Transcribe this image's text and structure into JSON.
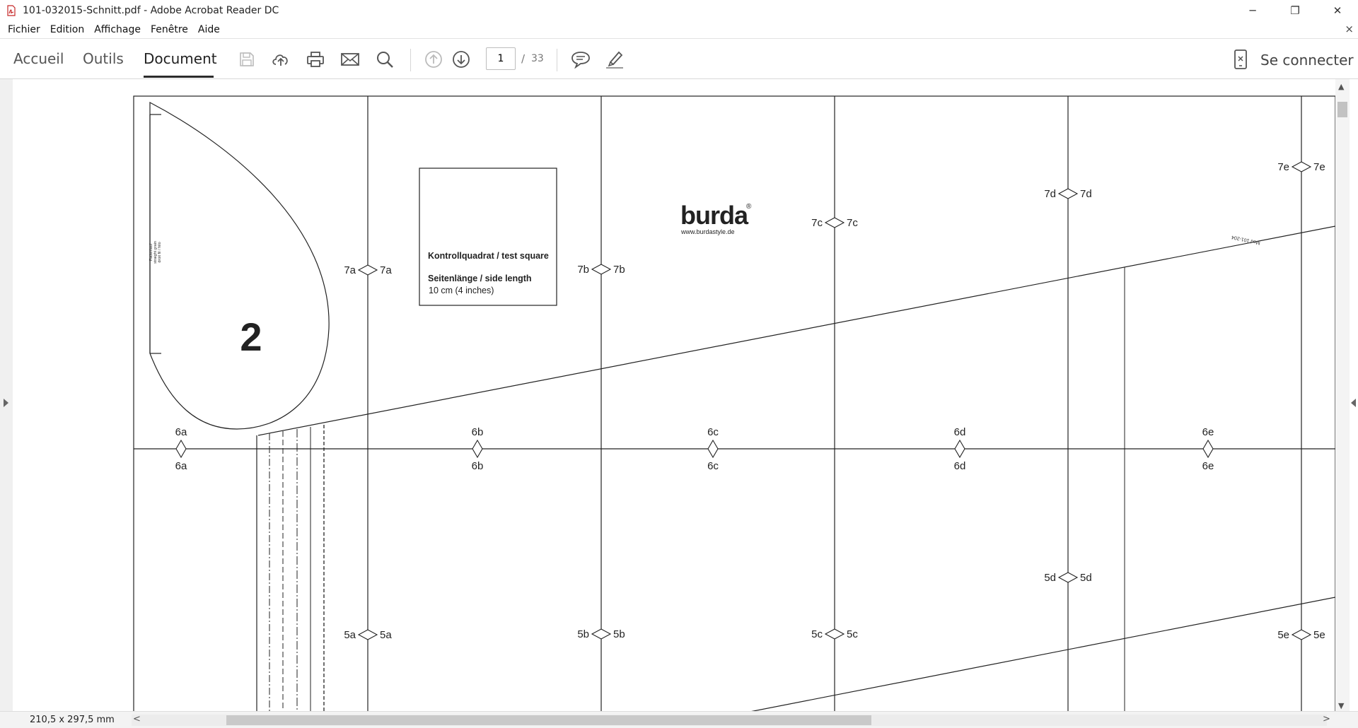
{
  "window": {
    "title": "101-032015-Schnitt.pdf - Adobe Acrobat Reader DC",
    "minimize": "─",
    "maximize": "❐",
    "close": "✕"
  },
  "menu": {
    "items": [
      "Fichier",
      "Edition",
      "Affichage",
      "Fenêtre",
      "Aide"
    ],
    "close_doc": "×"
  },
  "toolbar": {
    "tabs": [
      "Accueil",
      "Outils",
      "Document"
    ],
    "active_tab": "Document",
    "page_current": "1",
    "page_separator": "/",
    "page_total": "33",
    "connect_label": "Se connecter"
  },
  "document": {
    "piece_number": "2",
    "grain_text": [
      "Fadenlauf",
      "straight grain",
      "droit fil / hilo"
    ],
    "test_square": {
      "title": "Kontrollquadrat / test square",
      "side_label": "Seitenlänge / side length",
      "side_value": "10 cm (4 inches)"
    },
    "brand": "burda",
    "brand_mark": "®",
    "brand_url": "www.burdastyle.de",
    "line_label": "Mod 101-204",
    "markers_row7": [
      {
        "id": "7a",
        "left": "7a",
        "right": "7a"
      },
      {
        "id": "7b",
        "left": "7b",
        "right": "7b"
      },
      {
        "id": "7c",
        "left": "7c",
        "right": "7c"
      },
      {
        "id": "7d",
        "left": "7d",
        "right": "7d"
      },
      {
        "id": "7e",
        "left": "7e",
        "right": "7e"
      }
    ],
    "markers_row6": [
      {
        "id": "6a",
        "top": "6a",
        "bottom": "6a"
      },
      {
        "id": "6b",
        "top": "6b",
        "bottom": "6b"
      },
      {
        "id": "6c",
        "top": "6c",
        "bottom": "6c"
      },
      {
        "id": "6d",
        "top": "6d",
        "bottom": "6d"
      },
      {
        "id": "6e",
        "top": "6e",
        "bottom": "6e"
      }
    ],
    "markers_row5": [
      {
        "id": "5a",
        "left": "5a",
        "right": "5a"
      },
      {
        "id": "5b",
        "left": "5b",
        "right": "5b"
      },
      {
        "id": "5c",
        "left": "5c",
        "right": "5c"
      },
      {
        "id": "5d",
        "left": "5d",
        "right": "5d"
      },
      {
        "id": "5e",
        "left": "5e",
        "right": "5e"
      }
    ]
  },
  "status": {
    "page_size": "210,5 x 297,5 mm"
  },
  "scroll": {
    "up": "▲",
    "down": "▼",
    "left": "<",
    "right": ">"
  }
}
